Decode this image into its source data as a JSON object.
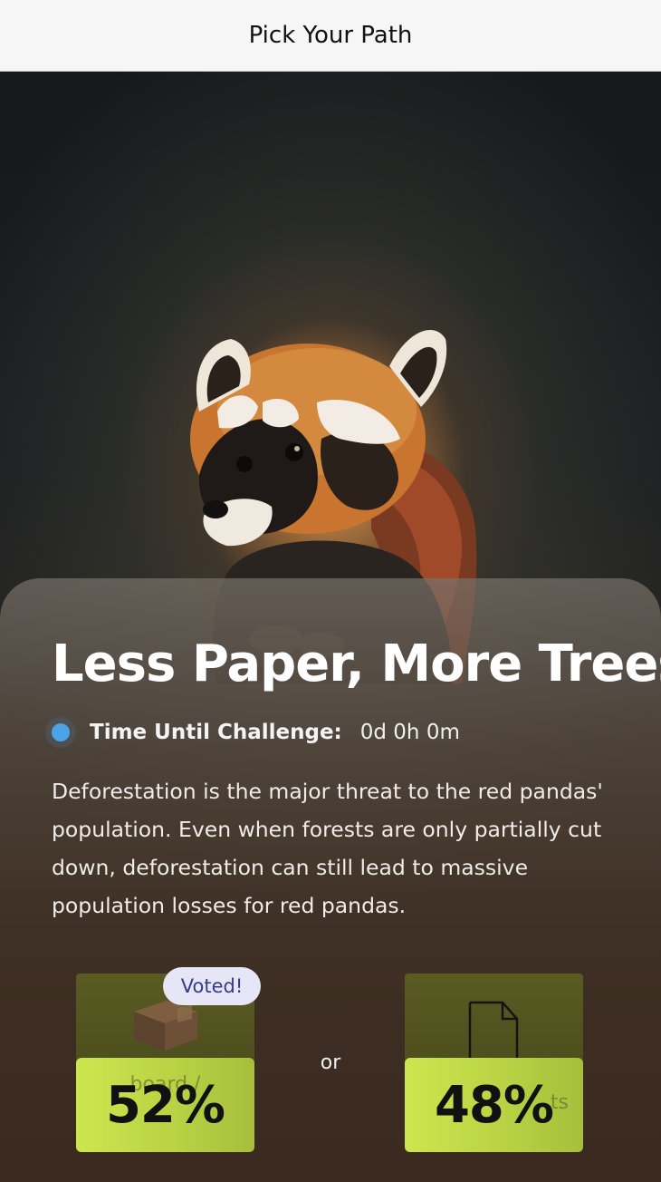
{
  "header": {
    "title": "Pick Your Path"
  },
  "challenge": {
    "title": "Less Paper, More Trees",
    "timer_label": "Time Until Challenge:",
    "timer_value": "0d 0h 0m",
    "description": "Deforestation is the major threat to the red pandas' population. Even when forests are only partially cut down, deforestation can still lead to massive population losses for red pandas."
  },
  "options": {
    "left": {
      "percent": "52%",
      "icon": "box-icon",
      "voted_badge": "Voted!",
      "ghost_label": "board /"
    },
    "right": {
      "percent": "48%",
      "icon": "document-icon",
      "ghost_label": "ts"
    },
    "separator": "or"
  },
  "colors": {
    "accent_dot": "#4aa3e6",
    "percent_bar": "#c4dc48",
    "voted_badge_bg": "#e6e6f6",
    "voted_badge_text": "#383a8a"
  }
}
